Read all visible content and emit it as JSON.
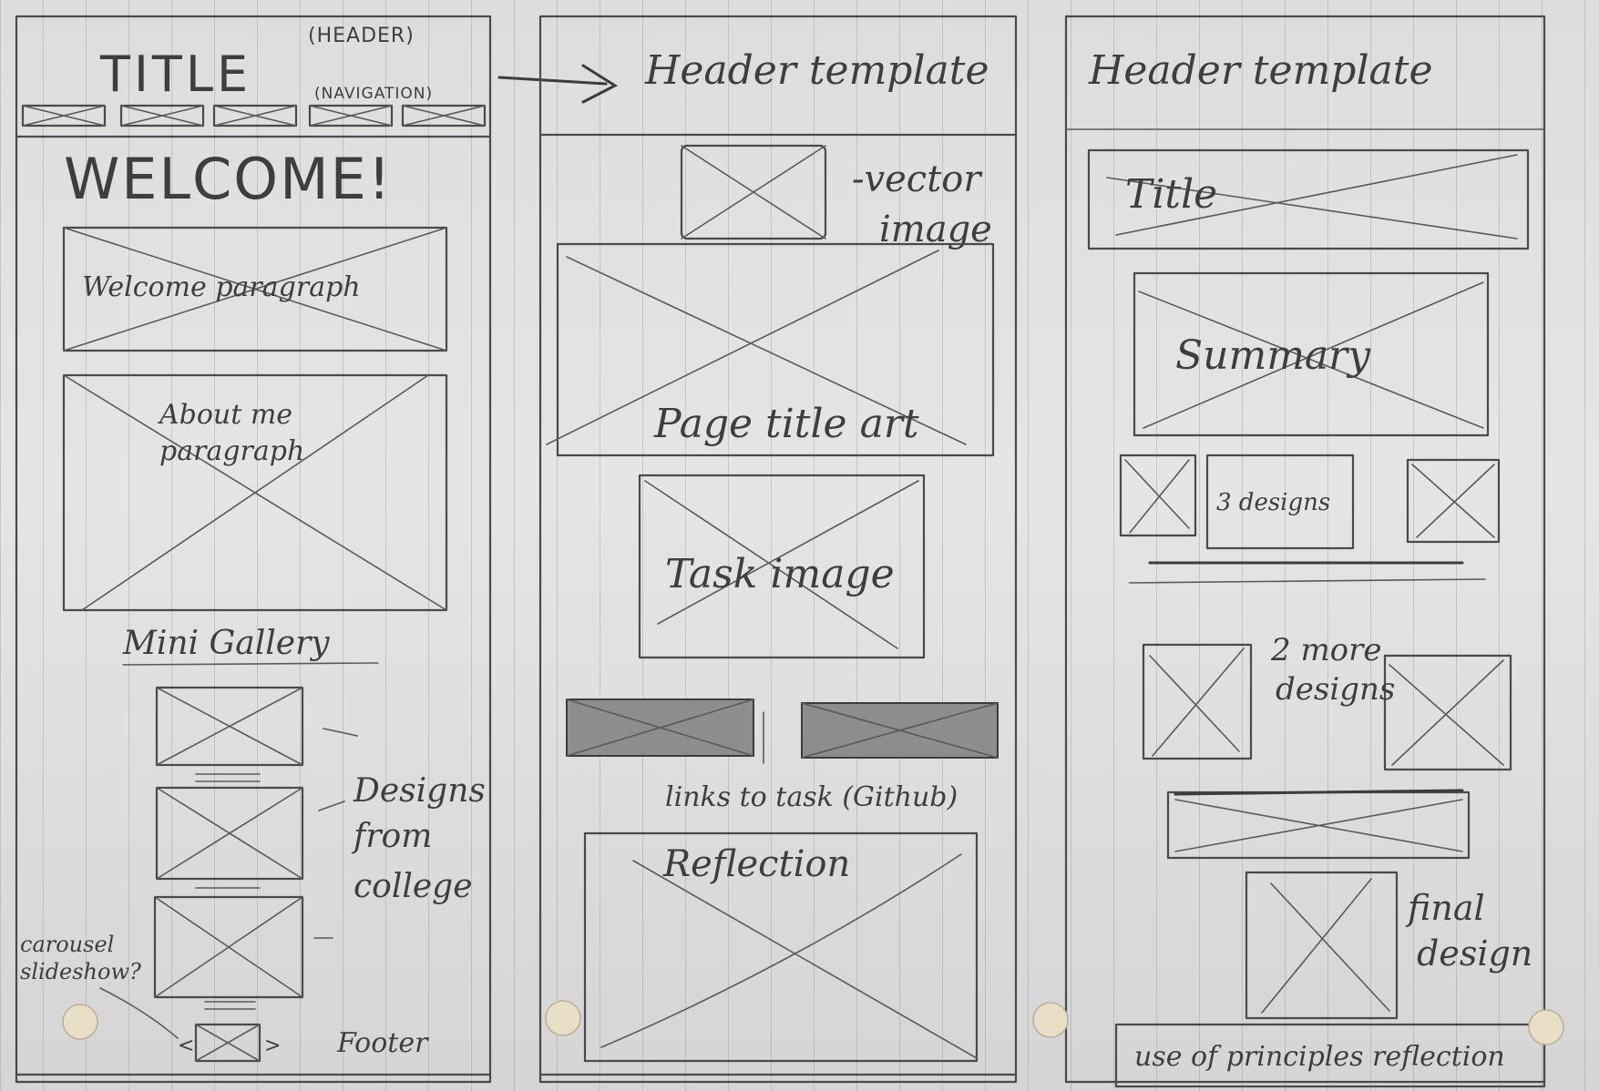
{
  "column1": {
    "title": "TITLE",
    "header_note": "(HEADER)",
    "navigation_note": "(NAVIGATION)",
    "welcome_heading": "WELCOME!",
    "welcome_paragraph": "Welcome paragraph",
    "about_line1": "About me",
    "about_line2": "paragraph",
    "mini_gallery": "Mini Gallery",
    "designs_line1": "Designs",
    "designs_line2": "from",
    "designs_line3": "college",
    "carousel_line1": "carousel",
    "carousel_line2": "slideshow?",
    "footer": "Footer"
  },
  "column2": {
    "header_template": "Header template",
    "vector_line1": "-vector",
    "vector_line2": "image",
    "page_title_art": "Page title art",
    "task_image": "Task image",
    "links_note": "links to task (Github)",
    "reflection": "Reflection"
  },
  "column3": {
    "header_template": "Header template",
    "title": "Title",
    "summary": "Summary",
    "three_designs": "3 designs",
    "two_more_line1": "2 more",
    "two_more_line2": "designs",
    "final_line1": "final",
    "final_line2": "design",
    "principles_reflection": "use of principles reflection"
  }
}
